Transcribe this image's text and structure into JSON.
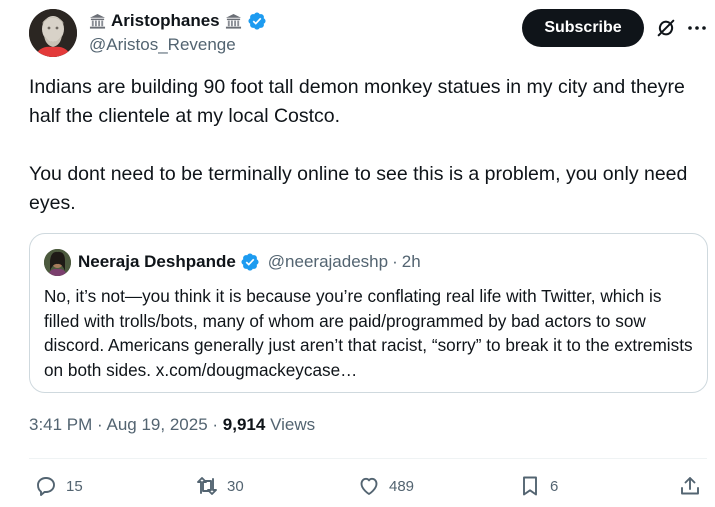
{
  "author": {
    "display_name": "Aristophanes",
    "handle": "@Aristos_Revenge",
    "verified": true,
    "name_emoji": "classical-building-icon"
  },
  "header": {
    "subscribe_label": "Subscribe",
    "icons": [
      "grok-icon",
      "more-icon"
    ]
  },
  "tweet": {
    "text": "Indians are building 90 foot tall demon monkey statues in my city and theyre half the clientele at my local Costco.\n\nYou dont need to be terminally online to see this is a problem, you only need eyes."
  },
  "quote": {
    "display_name": "Neeraja Deshpande",
    "handle": "@neerajadeshp",
    "time": "2h",
    "text": "No, it’s not—you think it is because you’re conflating real life with Twitter, which is filled with trolls/bots, many of whom are paid/programmed by bad actors to sow discord. Americans generally just aren’t that racist, “sorry” to break it to the extremists on both sides. x.com/dougmackeycase…"
  },
  "meta": {
    "time": "3:41 PM",
    "date": "Aug 19, 2025",
    "views_count": "9,914",
    "views_label": "Views"
  },
  "actions": {
    "replies": "15",
    "reposts": "30",
    "likes": "489",
    "bookmarks": "6"
  },
  "colors": {
    "text": "#0f1419",
    "secondary": "#536471",
    "verified": "#1d9bf0",
    "border": "#cfd9de"
  }
}
